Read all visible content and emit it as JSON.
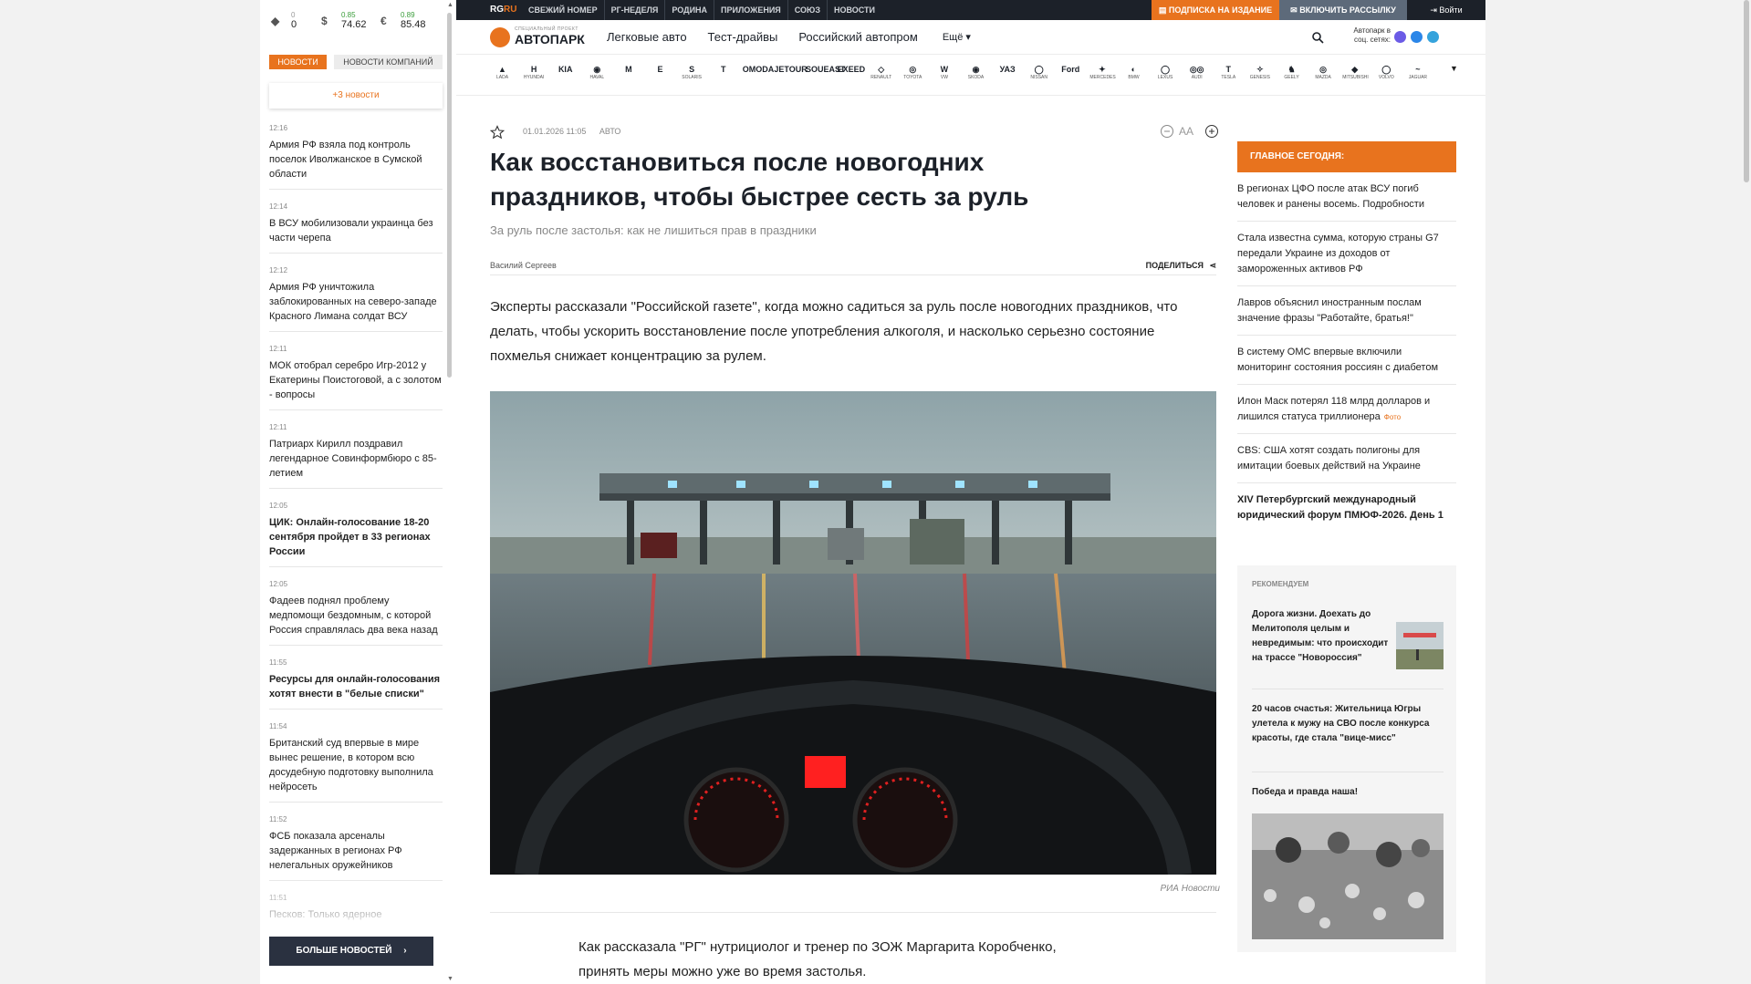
{
  "rates": [
    {
      "symbol": "◆",
      "change": "0",
      "value": "0",
      "up": false
    },
    {
      "symbol": "$",
      "change": "0.85",
      "value": "74.62",
      "up": true
    },
    {
      "symbol": "€",
      "change": "0.89",
      "value": "85.48",
      "up": true
    }
  ],
  "left_tabs": {
    "news": "Новости",
    "company_news": "Новости компаний"
  },
  "more_news_badge": "+3 новости",
  "news_feed": [
    {
      "time": "12:16",
      "text": "Армия РФ взяла под контроль поселок Иволжанское в Сумской области",
      "bold": false
    },
    {
      "time": "12:14",
      "text": "В ВСУ мобилизовали украинца без части черепа",
      "bold": false
    },
    {
      "time": "12:12",
      "text": "Армия РФ уничтожила заблокированных на северо-западе Красного Лимана солдат ВСУ",
      "bold": false
    },
    {
      "time": "12:11",
      "text": "МОК отобрал серебро Игр-2012 у Екатерины Поистоговой, а с золотом - вопросы",
      "bold": false
    },
    {
      "time": "12:11",
      "text": "Патриарх Кирилл поздравил легендарное Совинформбюро с 85-летием",
      "bold": false
    },
    {
      "time": "12:05",
      "text": "ЦИК: Онлайн-голосование 18-20 сентября пройдет в 33 регионах России",
      "bold": true
    },
    {
      "time": "12:05",
      "text": "Фадеев поднял проблему медпомощи бездомным, с которой Россия справлялась два века назад",
      "bold": false
    },
    {
      "time": "11:55",
      "text": "Ресурсы для онлайн-голосования хотят внести в \"белые списки\"",
      "bold": true
    },
    {
      "time": "11:54",
      "text": "Британский суд впервые в мире вынес решение, в котором всю досудебную подготовку выполнила нейросеть",
      "bold": false
    },
    {
      "time": "11:52",
      "text": "ФСБ показала арсеналы задержанных в регионах РФ нелегальных оружейников",
      "bold": false
    },
    {
      "time": "11:51",
      "text": "Песков: Только ядерное сдерживание оберегает мир от",
      "bold": false
    }
  ],
  "more_news_button": "Больше новостей",
  "topbar": {
    "logo_a": "RG",
    "logo_b": "RU",
    "links": [
      "Свежий номер",
      "РГ-Неделя",
      "Родина",
      "Приложения",
      "Союз",
      "Новости"
    ],
    "subscribe": "Подписка на издание",
    "mailing": "Включить рассылку",
    "login": "Войти"
  },
  "nav": {
    "brand_pre": "Специальный проект",
    "brand": "АВТОПАРК",
    "links": [
      "Легковые авто",
      "Тест-драйвы",
      "Российский автопром"
    ],
    "more": "Ещё ▾",
    "social_label": "Автопарк в соц. сетях:"
  },
  "car_brands": [
    {
      "glyph": "▲",
      "name": "LADA"
    },
    {
      "glyph": "H",
      "name": "HYUNDAI"
    },
    {
      "glyph": "KIA",
      "name": ""
    },
    {
      "glyph": "◉",
      "name": "HAVAL"
    },
    {
      "glyph": "M",
      "name": ""
    },
    {
      "glyph": "E",
      "name": ""
    },
    {
      "glyph": "S",
      "name": "SOLARIS"
    },
    {
      "glyph": "T",
      "name": ""
    },
    {
      "glyph": "OMODA",
      "name": ""
    },
    {
      "glyph": "JETOUR",
      "name": ""
    },
    {
      "glyph": "SOUEAST",
      "name": ""
    },
    {
      "glyph": "EXEED",
      "name": ""
    },
    {
      "glyph": "◇",
      "name": "RENAULT"
    },
    {
      "glyph": "◎",
      "name": "TOYOTA"
    },
    {
      "glyph": "W",
      "name": "VW"
    },
    {
      "glyph": "◉",
      "name": "SKODA"
    },
    {
      "glyph": "УАЗ",
      "name": ""
    },
    {
      "glyph": "◯",
      "name": "NISSAN"
    },
    {
      "glyph": "Ford",
      "name": ""
    },
    {
      "glyph": "✦",
      "name": "MERCEDES"
    },
    {
      "glyph": "◐",
      "name": "BMW"
    },
    {
      "glyph": "◯",
      "name": "LEXUS"
    },
    {
      "glyph": "◎◎",
      "name": "AUDI"
    },
    {
      "glyph": "T",
      "name": "TESLA"
    },
    {
      "glyph": "✧",
      "name": "GENESIS"
    },
    {
      "glyph": "♞",
      "name": "GEELY"
    },
    {
      "glyph": "◎",
      "name": "MAZDA"
    },
    {
      "glyph": "◆",
      "name": "MITSUBISHI"
    },
    {
      "glyph": "◯",
      "name": "VOLVO"
    },
    {
      "glyph": "~",
      "name": "JAGUAR"
    }
  ],
  "article": {
    "date": "01.01.2026 11:05",
    "rubric": "АВТО",
    "title": "Как восстановиться после новогодних праздников, чтобы быстрее сесть за руль",
    "subtitle": "За руль после застолья: как не лишиться прав в праздники",
    "author": "Василий Сергеев",
    "share": "Поделиться",
    "font_label": "AA",
    "lead": "Эксперты рассказали \"Российской газете\", когда можно садиться за руль после новогодних праздников, что делать, чтобы ускорить восстановление после употребления алкоголя, и насколько серьезно состояние похмелья снижает концентрацию за рулем.",
    "photo_credit": "РИА Новости",
    "body": "Как рассказала \"РГ\" нутрициолог и тренер по ЗОЖ Маргарита Коробченко, принять меры можно уже во время застолья."
  },
  "today": {
    "heading": "Главное сегодня:",
    "items": [
      {
        "text": "В регионах ЦФО после атак ВСУ погиб человек и ранены восемь. Подробности",
        "tag": ""
      },
      {
        "text": "Стала известна сумма, которую страны G7 передали Украине из доходов от замороженных активов РФ",
        "tag": ""
      },
      {
        "text": "Лавров объяснил иностранным послам значение фразы \"Работайте, братья!\"",
        "tag": ""
      },
      {
        "text": "В систему ОМС впервые включили мониторинг состояния россиян с диабетом",
        "tag": ""
      },
      {
        "text": "Илон Маск потерял 118 млрд долларов и лишился статуса триллионера",
        "tag": "Фото"
      },
      {
        "text": "CBS: США хотят создать полигоны для имитации боевых действий на Украине",
        "tag": ""
      },
      {
        "text": "XIV Петербургский международный юридический форум ПМЮФ-2026. День 1",
        "tag": ""
      }
    ]
  },
  "recommend": {
    "heading": "Рекомендуем",
    "items": [
      "Дорога жизни. Доехать до Мелитополя целым и невредимым: что происходит на трассе \"Новороссия\"",
      "20 часов счастья: Жительница Югры улетела к мужу на СВО после конкурса красоты, где стала \"вице-мисс\"",
      "Победа и правда наша!"
    ]
  },
  "colors": {
    "accent": "#e8731e",
    "dark": "#1c2129"
  }
}
